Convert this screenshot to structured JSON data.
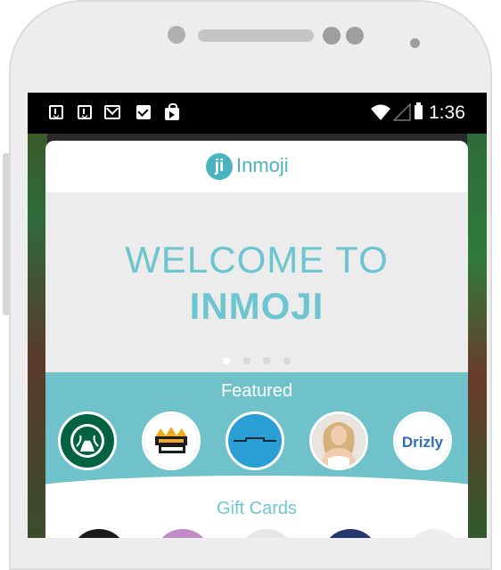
{
  "status_bar": {
    "icons": [
      "download-icon",
      "download-icon",
      "gmail-icon",
      "checkbox-icon",
      "play-store-icon"
    ],
    "right_icons": [
      "wifi-icon",
      "signal-icon",
      "battery-icon"
    ],
    "time": "1:36"
  },
  "header": {
    "logo_letter": "ji",
    "app_name": "Inmoji"
  },
  "welcome": {
    "line1": "WELCOME TO",
    "line2": "INMOJI",
    "pages": 4,
    "active_page": 1
  },
  "featured": {
    "title": "Featured",
    "items": [
      {
        "name": "starbucks-logo",
        "color": "#006241"
      },
      {
        "name": "draftkings-logo",
        "color": "#1b1b1b"
      },
      {
        "name": "box-logo",
        "color": "#2a9fd6"
      },
      {
        "name": "person-logo",
        "color": "#e6c9b2"
      },
      {
        "name": "drizly-logo",
        "label": "Drizly",
        "color": "#2f6db5"
      }
    ]
  },
  "gift_cards": {
    "title": "Gift Cards"
  },
  "colors": {
    "accent": "#6fc2c9",
    "accent_text": "#6cc5cf",
    "welcome_bg": "#ececec"
  }
}
